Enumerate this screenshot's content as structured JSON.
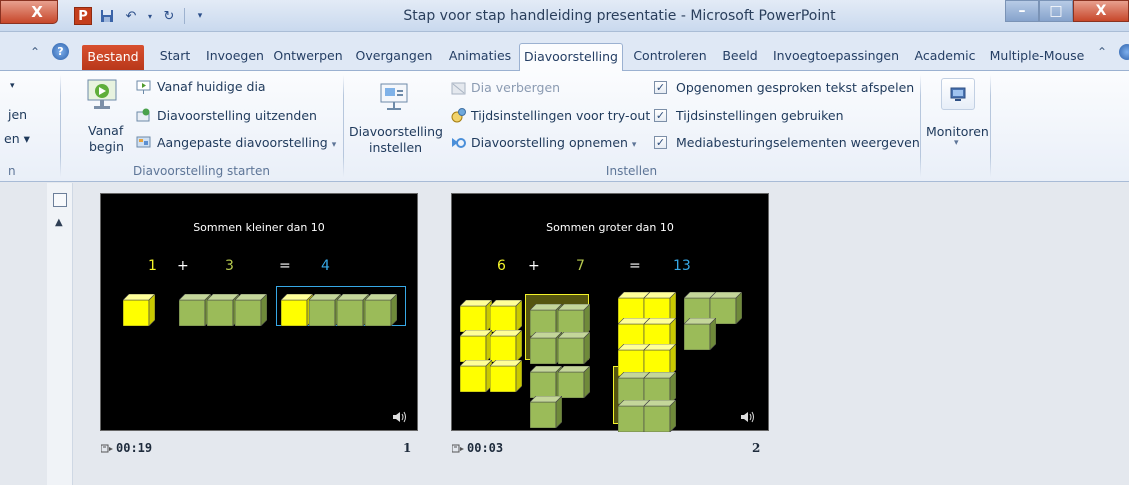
{
  "window": {
    "close_left": "X",
    "app_icon": "P",
    "title": "Stap voor stap handleiding presentatie - Microsoft PowerPoint",
    "min_label": "–",
    "max_label": "□",
    "close_label": "X"
  },
  "tabs": {
    "file": "Bestand",
    "start": "Start",
    "insert": "Invoegen",
    "design": "Ontwerpen",
    "transitions": "Overgangen",
    "animations": "Animaties",
    "slideshow": "Diavoorstelling",
    "review": "Controleren",
    "view": "Beeld",
    "addins": "Invoegtoepassingen",
    "academic": "Academic",
    "multimouse": "Multiple-Mouse"
  },
  "ribbon": {
    "left_partial": [
      "▾",
      "jen",
      "en ▾",
      "n"
    ],
    "start_group": {
      "from_begin_line1": "Vanaf",
      "from_begin_line2": "begin",
      "from_current": "Vanaf huidige dia",
      "broadcast": "Diavoorstelling uitzenden",
      "custom": "Aangepaste diavoorstelling",
      "label": "Diavoorstelling starten"
    },
    "setup_group": {
      "setup_line1": "Diavoorstelling",
      "setup_line2": "instellen",
      "hide_slide": "Dia verbergen",
      "rehearse": "Tijdsinstellingen voor try-out",
      "record": "Diavoorstelling opnemen",
      "play_narrations": "Opgenomen gesproken tekst afspelen",
      "use_timings": "Tijdsinstellingen gebruiken",
      "show_media_controls": "Mediabesturingselementen weergeven",
      "play_narrations_checked": true,
      "use_timings_checked": true,
      "show_media_controls_checked": true,
      "label": "Instellen"
    },
    "monitors_group": {
      "label": "Monitoren",
      "dropdown": "▾"
    }
  },
  "slides": [
    {
      "title": "Sommen  kleiner dan 10",
      "equation": {
        "a": "1",
        "op": "+",
        "b": "3",
        "eq": "=",
        "result": "4"
      },
      "time": "00:19",
      "number": "1"
    },
    {
      "title": "Sommen  groter dan 10",
      "equation": {
        "a": "6",
        "op": "+",
        "b": "7",
        "eq": "=",
        "result": "13"
      },
      "time": "00:03",
      "number": "2"
    }
  ],
  "colors": {
    "number_yellow": "#f3f32a",
    "number_green": "#b6c94e",
    "number_blue": "#37a8e6",
    "cube_yellow": "#ffff00",
    "cube_green": "#9bbb59"
  }
}
